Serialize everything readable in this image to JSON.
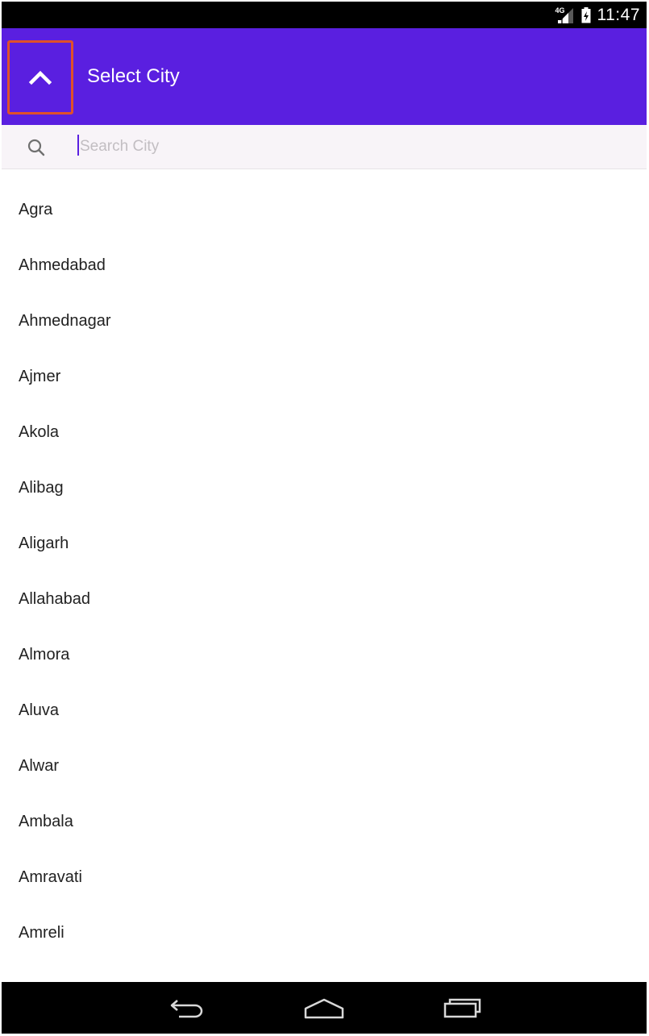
{
  "status_bar": {
    "network_type": "4G",
    "time": "11:47",
    "icons": [
      "signal-icon",
      "battery-icon"
    ]
  },
  "app_bar": {
    "title": "Select City",
    "up_icon": "chevron-up-icon",
    "background": "#5a1fe0",
    "highlight": "#e0502a"
  },
  "search": {
    "icon": "search-icon",
    "placeholder": "Search City",
    "value": ""
  },
  "cities": [
    "Agra",
    "Ahmedabad",
    "Ahmednagar",
    "Ajmer",
    "Akola",
    "Alibag",
    "Aligarh",
    "Allahabad",
    "Almora",
    "Aluva",
    "Alwar",
    "Ambala",
    "Amravati",
    "Amreli"
  ],
  "nav_bar": {
    "icons": [
      "back-icon",
      "home-icon",
      "recents-icon"
    ]
  }
}
